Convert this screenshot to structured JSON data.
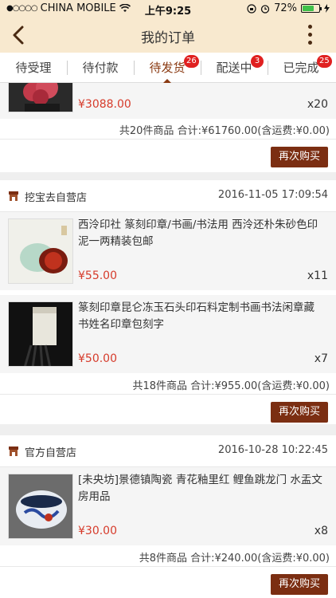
{
  "status_bar": {
    "signal_dots": "●○○○○",
    "carrier": "CHINA MOBILE",
    "time": "上午9:25",
    "battery_percent": "72%",
    "battery_level": 0.72
  },
  "nav": {
    "title": "我的订单"
  },
  "tabs": [
    {
      "label": "待受理",
      "badge": ""
    },
    {
      "label": "待付款",
      "badge": ""
    },
    {
      "label": "待发货",
      "badge": "26"
    },
    {
      "label": "配送中",
      "badge": "3"
    },
    {
      "label": "已完成",
      "badge": "25"
    }
  ],
  "orders": [
    {
      "items": [
        {
          "price": "¥3088.00",
          "qty": "x20"
        }
      ],
      "summary": "共20件商品 合计:¥61760.00(含运费:¥0.00)",
      "rebuy_label": "再次购买"
    },
    {
      "shop": "挖宝去自营店",
      "time": "2016-11-05 17:09:54",
      "items": [
        {
          "title": "西泠印社 篆刻印章/书画/书法用 西泠还朴朱砂色印泥一两精装包邮",
          "price": "¥55.00",
          "qty": "x11"
        },
        {
          "title": "篆刻印章昆仑冻玉石头印石料定制书画书法闲章藏书姓名印章包刻字",
          "price": "¥50.00",
          "qty": "x7"
        }
      ],
      "summary": "共18件商品 合计:¥955.00(含运费:¥0.00)",
      "rebuy_label": "再次购买"
    },
    {
      "shop": "官方自营店",
      "time": "2016-10-28 10:22:45",
      "items": [
        {
          "title": "[未央坊]景德镇陶瓷 青花釉里红 鲤鱼跳龙门 水盂文房用品",
          "price": "¥30.00",
          "qty": "x8"
        }
      ],
      "summary": "共8件商品 合计:¥240.00(含运费:¥0.00)",
      "rebuy_label": "再次购买"
    }
  ],
  "colors": {
    "header_bg": "#f8e9cf",
    "accent": "#8a3a12",
    "button_bg": "#7b2e12",
    "price": "#d63b2b",
    "badge": "#e02020"
  }
}
